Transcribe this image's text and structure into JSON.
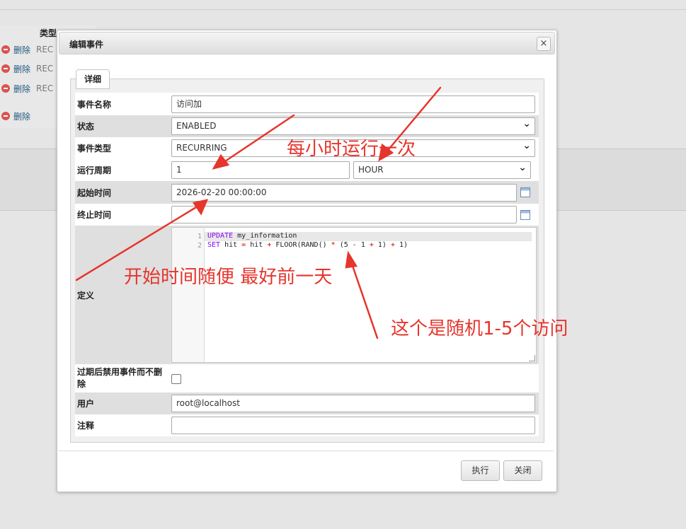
{
  "background": {
    "column_header": "类型",
    "rows": [
      {
        "action": "删除",
        "type": "REC"
      },
      {
        "action": "删除",
        "type": "REC"
      },
      {
        "action": "删除",
        "type": "REC"
      },
      {
        "action": "删除",
        "type": ""
      }
    ]
  },
  "dialog": {
    "title": "编辑事件",
    "close_icon": "×",
    "tab_label": "详细",
    "fields": {
      "event_name": {
        "label": "事件名称",
        "value": "访问加"
      },
      "status": {
        "label": "状态",
        "value": "ENABLED"
      },
      "event_type": {
        "label": "事件类型",
        "value": "RECURRING"
      },
      "interval": {
        "label": "运行周期",
        "value": "1",
        "unit": "HOUR"
      },
      "starts": {
        "label": "起始时间",
        "value": "2026-02-20 00:00:00"
      },
      "ends": {
        "label": "终止时间",
        "value": ""
      },
      "definition": {
        "label": "定义",
        "lines": [
          {
            "num": "1"
          },
          {
            "num": "2"
          }
        ],
        "code_text": {
          "l1_kw": "UPDATE",
          "l1_rest": " my_information",
          "l2_kw": "SET",
          "l2_a": " hit ",
          "l2_op1": "=",
          "l2_b": " hit ",
          "l2_op2": "+",
          "l2_c": " FLOOR(RAND() ",
          "l2_op3": "*",
          "l2_d": " (5 ",
          "l2_op4": "-",
          "l2_e": " 1 ",
          "l2_op5": "+",
          "l2_f": " 1) ",
          "l2_op6": "+",
          "l2_g": " 1)"
        }
      },
      "preserve": {
        "label": "过期后禁用事件而不删除",
        "checked": false
      },
      "definer": {
        "label": "用户",
        "value": "root@localhost"
      },
      "comment": {
        "label": "注释",
        "value": ""
      }
    },
    "buttons": {
      "execute": "执行",
      "close": "关闭"
    }
  },
  "annotations": {
    "hourly": "每小时运行一次",
    "start_time": "开始时间随便 最好前一天",
    "random": "这个是随机1-5个访问",
    "color": "#e6352d"
  }
}
